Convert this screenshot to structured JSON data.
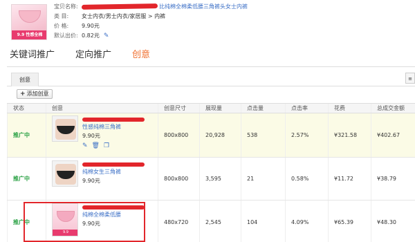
{
  "product": {
    "name_label": "宝贝名称:",
    "name_value": "比纯棉全棉柔低腰三角裤头女士内裤",
    "category_label": "类    目:",
    "category_value": "女士内衣/男士内衣/家居服 > 内裤",
    "price_label": "价    格:",
    "price_value": "9.90元",
    "default_bid_label": "默认出价:",
    "default_bid_value": "0.82元",
    "thumb_text": "9.9 性感全棉"
  },
  "tabs": [
    {
      "label": "关键词推广"
    },
    {
      "label": "定向推广"
    },
    {
      "label": "创意"
    }
  ],
  "panel": {
    "tab_label": "创意",
    "add_button_label": "添加创意",
    "right_button_label": "≡"
  },
  "table": {
    "headers": [
      "状态",
      "创意",
      "创意尺寸",
      "展现量",
      "点击量",
      "点击率",
      "花费",
      "总成交金额"
    ],
    "rows": [
      {
        "status": "推广中",
        "title": "性感纯棉三角裤",
        "price": "9.90元",
        "size": "800x800",
        "impressions": "20,928",
        "clicks": "538",
        "ctr": "2.57%",
        "cost": "¥321.58",
        "gmv": "¥402.67"
      },
      {
        "status": "推广中",
        "title": "纯棉女生三角裤",
        "price": "9.90元",
        "size": "800x800",
        "impressions": "3,595",
        "clicks": "21",
        "ctr": "0.58%",
        "cost": "¥11.72",
        "gmv": "¥38.79"
      },
      {
        "status": "推广中",
        "title": "纯棉全棉柔低腰",
        "price": "9.90元",
        "size": "480x720",
        "impressions": "2,545",
        "clicks": "104",
        "ctr": "4.09%",
        "cost": "¥65.39",
        "gmv": "¥48.30"
      }
    ]
  },
  "colors": {
    "accent": "#f06e2d",
    "link": "#3b6fc6",
    "status": "#2aa144",
    "redact": "#e2262b"
  }
}
